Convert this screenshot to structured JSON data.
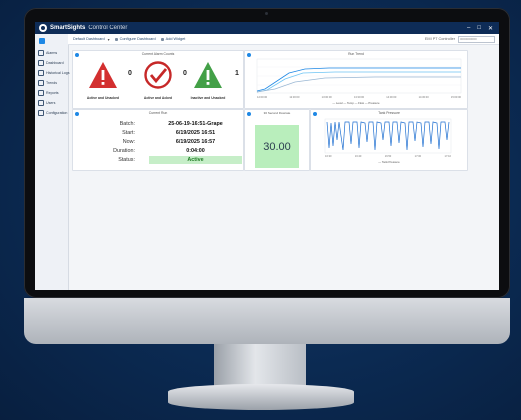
{
  "app": {
    "brand": "SmartSights",
    "title": "Control Center",
    "window_buttons": [
      "–",
      "□",
      "✕"
    ]
  },
  "sidebar": {
    "items": [
      {
        "label": "Alarms",
        "icon": "bell-icon"
      },
      {
        "label": "Dashboard",
        "icon": "dashboard-icon"
      },
      {
        "label": "Historical Logs",
        "icon": "history-icon"
      },
      {
        "label": "Trends",
        "icon": "trend-icon"
      },
      {
        "label": "Reports",
        "icon": "report-icon"
      },
      {
        "label": "Users",
        "icon": "user-icon"
      },
      {
        "label": "Configuration",
        "icon": "gear-icon"
      }
    ]
  },
  "toolbar": {
    "dashboard_select": "Default Dashboard",
    "configure_label": "Configure Dashboard",
    "add_widget_label": "Add Widget",
    "right_label": "EMI PT Controller",
    "right_value": "0000000000"
  },
  "alarms": {
    "title": "Current Alarm Counts",
    "items": [
      {
        "label": "Active and Unacked",
        "count": "0",
        "color": "#d32f2f"
      },
      {
        "label": "Active and Acked",
        "count": "0",
        "color": "#c62828"
      },
      {
        "label": "Inactive and Unacked",
        "count": "1",
        "color": "#43a047"
      }
    ]
  },
  "run_trend": {
    "title": "Run Trend",
    "legend": "— Level — Temp — Flow — Pressure",
    "x_ticks": [
      "12:00:00",
      "12:30:00",
      "13:00:00",
      "13:30:00",
      "14:00:00",
      "14:30:00",
      "15:00:00"
    ]
  },
  "batch": {
    "title": "Current Run",
    "rows": [
      {
        "key": "Batch:",
        "value": "25-06-19-16:51-Grape"
      },
      {
        "key": "Start:",
        "value": "6/19/2025 16:51"
      },
      {
        "key": "Now:",
        "value": "6/19/2025 16:57"
      },
      {
        "key": "Duration:",
        "value": "0:04:00"
      },
      {
        "key": "Status:",
        "value": "Active"
      }
    ]
  },
  "flow_panel": {
    "title": "30 Second Flowrate",
    "value": "30.00"
  },
  "tank_panel": {
    "title": "Tank Pressure",
    "legend": "— Tank Pressure",
    "x_ticks": [
      "16:30",
      "16:40",
      "16:50",
      "17:00",
      "17:10"
    ]
  }
}
